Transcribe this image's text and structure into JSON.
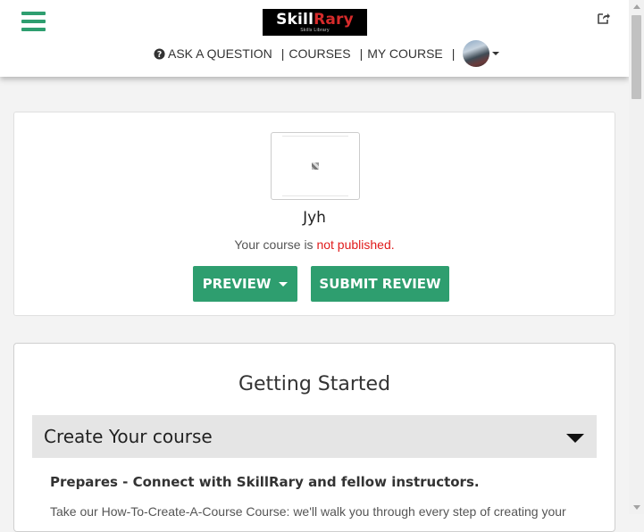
{
  "header": {
    "logo": {
      "main": "SkillRary",
      "main_plain": "Skill",
      "main_accent": "Rary",
      "tagline": "Skills Library"
    },
    "nav": {
      "ask_question": "ASK A QUESTION",
      "courses": "COURSES",
      "my_course": "MY COURSE",
      "separator": "|"
    },
    "icons": [
      "hamburger-menu-icon",
      "share-icon",
      "question-circle-icon",
      "chevron-down-icon"
    ]
  },
  "course": {
    "title": "Jyh",
    "status_prefix": "Your course is ",
    "status_value": "not published.",
    "preview_label": "PREVIEW",
    "submit_label": "SUBMIT REVIEW"
  },
  "getting_started": {
    "title": "Getting Started",
    "accordion_label": "Create Your course",
    "heading": "Prepares - Connect with SkillRary and fellow instructors.",
    "description": "Take our How-To-Create-A-Course Course: we'll walk you through every step of creating your"
  },
  "colors": {
    "brand_green": "#2e9e6f",
    "status_red": "#e01b1b",
    "accordion_bg": "#e5e5e5"
  }
}
